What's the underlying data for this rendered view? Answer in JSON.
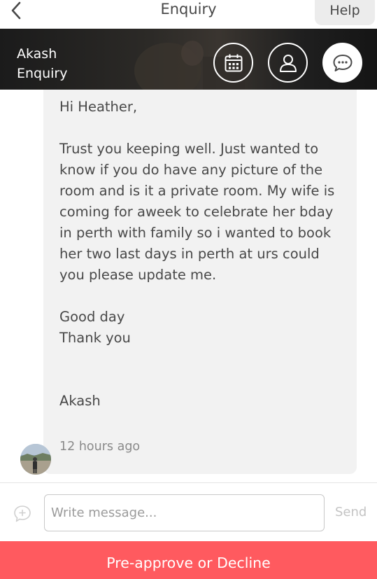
{
  "header": {
    "title": "Enquiry",
    "help_label": "Help"
  },
  "hero": {
    "guest_name": "Akash",
    "status": "Enquiry",
    "icons": [
      "calendar-icon",
      "profile-icon",
      "message-icon"
    ]
  },
  "message": {
    "text": "Hi Heather,\n\nTrust you keeping well. Just wanted to know if you do have any picture of the room and is it a private room. My wife is coming for  aweek to celebrate her bday in perth with family so i wanted to book her two last days in perth at urs could you please update me.\n\nGood day\nThank you\n\n\nAkash",
    "timestamp": "12 hours ago"
  },
  "composer": {
    "placeholder": "Write message...",
    "value": "",
    "send_label": "Send"
  },
  "cta": {
    "label": "Pre-approve or Decline"
  },
  "colors": {
    "accent": "#ff5a5f",
    "bubble": "#f2f2f2",
    "text": "#484848"
  }
}
